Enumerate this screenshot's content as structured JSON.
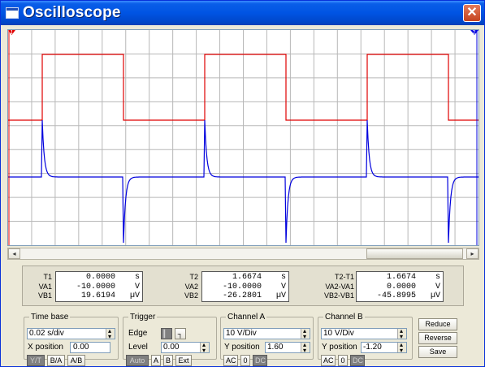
{
  "window": {
    "title": "Oscilloscope",
    "close_glyph": "✕"
  },
  "screen": {
    "cursor1_label": "1",
    "cursor2_label": "2",
    "colors": {
      "channel_a": "#e00000",
      "channel_b": "#0000dd",
      "grid": "#b8b8b8",
      "cursor1": "#e00000",
      "cursor2": "#0000dd"
    }
  },
  "scrollbar": {
    "left_arrow": "◂",
    "right_arrow": "▸"
  },
  "readouts": {
    "t1": {
      "labels": [
        "T1",
        "VA1",
        "VB1"
      ],
      "values": [
        "0.0000",
        "-10.0000",
        "19.6194"
      ],
      "units": [
        "s",
        "V",
        "µV"
      ]
    },
    "t2": {
      "labels": [
        "T2",
        "VA2",
        "VB2"
      ],
      "values": [
        "1.6674",
        "-10.0000",
        "-26.2801"
      ],
      "units": [
        "s",
        "V",
        "µV"
      ]
    },
    "diff": {
      "labels": [
        "T2-T1",
        "VA2-VA1",
        "VB2-VB1"
      ],
      "values": [
        "1.6674",
        "0.0000",
        "-45.8995"
      ],
      "units": [
        "s",
        "V",
        "µV"
      ]
    }
  },
  "timebase": {
    "legend": "Time base",
    "scale": "0.02 s/div",
    "xpos_label": "X position",
    "xpos": "0.00",
    "modes": [
      "Y/T",
      "B/A",
      "A/B"
    ]
  },
  "trigger": {
    "legend": "Trigger",
    "edge_label": "Edge",
    "level_label": "Level",
    "level": "0.00",
    "rising_glyph": "▎",
    "falling_glyph": "┐",
    "sources": [
      "Auto",
      "A",
      "B",
      "Ext"
    ]
  },
  "channel_a": {
    "legend": "Channel A",
    "scale": "10 V/Div",
    "ypos_label": "Y position",
    "ypos": "1.60",
    "coupling": [
      "AC",
      "0",
      "DC"
    ]
  },
  "channel_b": {
    "legend": "Channel B",
    "scale": "10 V/Div",
    "ypos_label": "Y position",
    "ypos": "-1.20",
    "coupling": [
      "AC",
      "0",
      "DC"
    ]
  },
  "actions": {
    "reduce": "Reduce",
    "reverse": "Reverse",
    "save": "Save"
  }
}
